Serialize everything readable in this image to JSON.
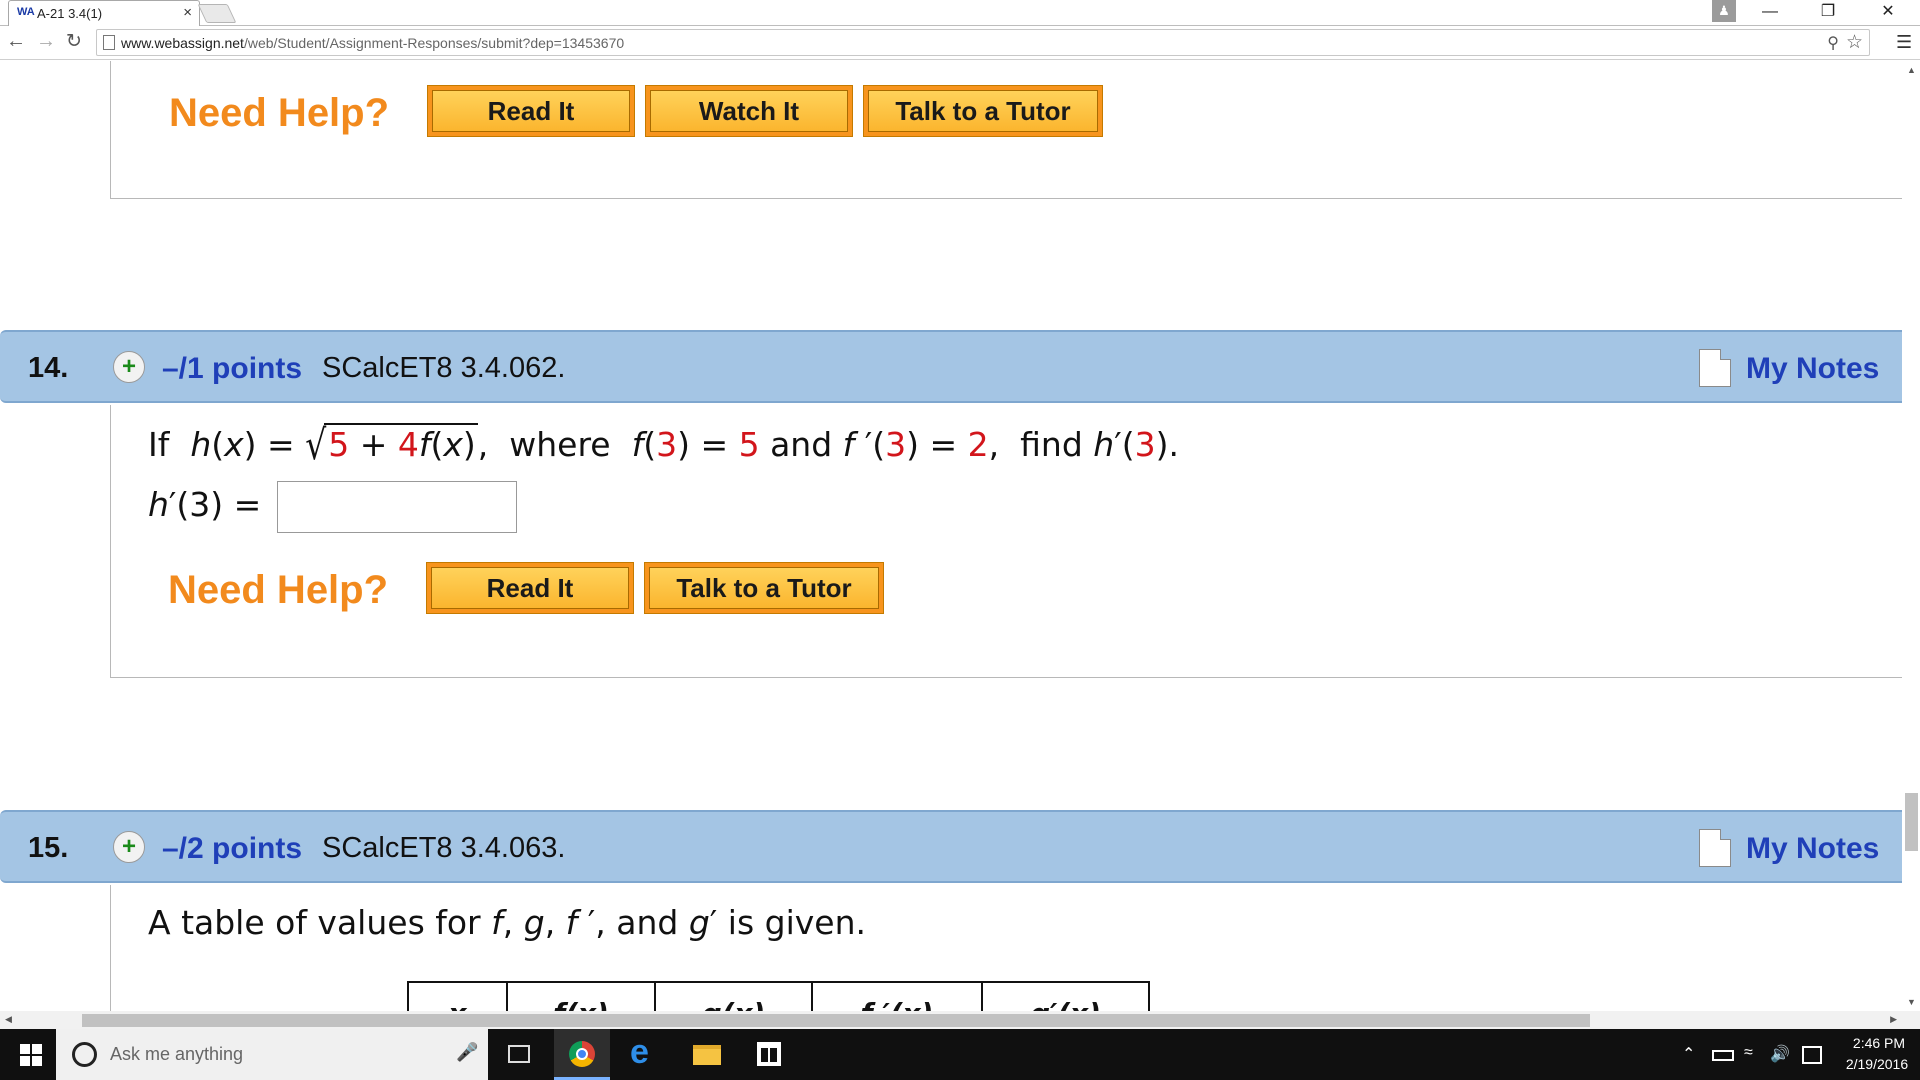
{
  "browser": {
    "tab_favicon": "WA",
    "tab_title": "A-21 3.4(1)",
    "tab_close": "×",
    "url_host": "www.webassign.net",
    "url_path": "/web/Student/Assignment-Responses/submit?dep=13453670"
  },
  "previous_question": {
    "need_help_label": "Need Help?",
    "buttons": [
      "Read It",
      "Watch It",
      "Talk to a Tutor"
    ]
  },
  "question_14": {
    "number": "14.",
    "points": "–/1 points",
    "reference": "SCalcET8 3.4.062.",
    "my_notes": "My Notes",
    "answer_label_prefix": "h",
    "answer_label_suffix": "′(3) =",
    "answer_value": "",
    "need_help_label": "Need Help?",
    "buttons": [
      "Read It",
      "Talk to a Tutor"
    ]
  },
  "question_15": {
    "number": "15.",
    "points": "–/2 points",
    "reference": "SCalcET8 3.4.063.",
    "my_notes": "My Notes",
    "prompt_start": "A table of values for ",
    "prompt_end": " is given.",
    "table_headers": [
      "x",
      "f(x)",
      "g(x)",
      "f ′(x)",
      "g′(x)"
    ]
  },
  "taskbar": {
    "search_placeholder": "Ask me anything",
    "time": "2:46 PM",
    "date": "2/19/2016"
  },
  "colors": {
    "header_bg": "#a4c5e4",
    "link_blue": "#1f3fb8",
    "need_help_orange": "#f28a1d",
    "value_red": "#d2151b",
    "button_gold": "#fbb52e"
  }
}
